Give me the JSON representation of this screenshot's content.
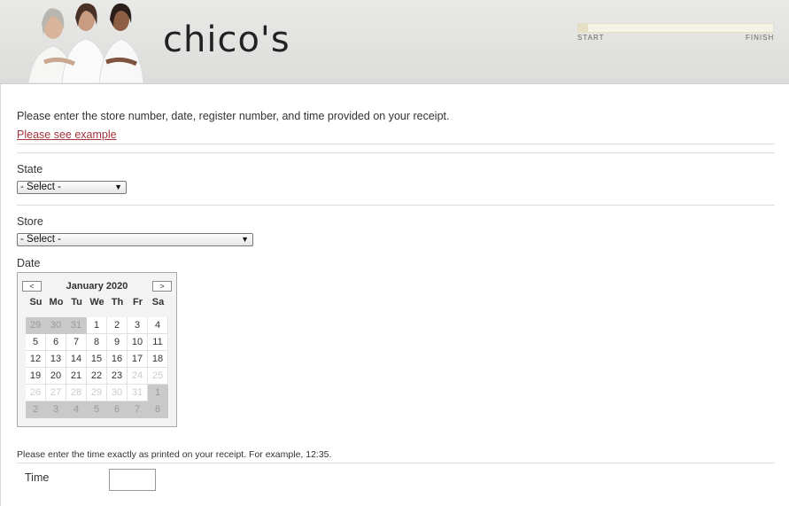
{
  "header": {
    "logo_text": "chico's",
    "progress": {
      "start_label": "START",
      "finish_label": "FINISH",
      "fraction": 0.05
    }
  },
  "intro": {
    "text": "Please enter the store number, date, register number, and time provided on your receipt.",
    "example_link": "Please see example"
  },
  "state": {
    "label": "State",
    "selected": "- Select -"
  },
  "store": {
    "label": "Store",
    "selected": "- Select -"
  },
  "date": {
    "label": "Date",
    "calendar": {
      "title": "January 2020",
      "prev_icon": "chevron-left-icon",
      "next_icon": "chevron-right-icon",
      "weekdays": [
        "Su",
        "Mo",
        "Tu",
        "We",
        "Th",
        "Fr",
        "Sa"
      ],
      "weeks": [
        [
          {
            "d": "29",
            "s": "other"
          },
          {
            "d": "30",
            "s": "other"
          },
          {
            "d": "31",
            "s": "other"
          },
          {
            "d": "1",
            "s": "active"
          },
          {
            "d": "2",
            "s": "active"
          },
          {
            "d": "3",
            "s": "active"
          },
          {
            "d": "4",
            "s": "active"
          }
        ],
        [
          {
            "d": "5",
            "s": "active"
          },
          {
            "d": "6",
            "s": "active"
          },
          {
            "d": "7",
            "s": "active"
          },
          {
            "d": "8",
            "s": "active"
          },
          {
            "d": "9",
            "s": "active"
          },
          {
            "d": "10",
            "s": "active"
          },
          {
            "d": "11",
            "s": "active"
          }
        ],
        [
          {
            "d": "12",
            "s": "active"
          },
          {
            "d": "13",
            "s": "active"
          },
          {
            "d": "14",
            "s": "active"
          },
          {
            "d": "15",
            "s": "active"
          },
          {
            "d": "16",
            "s": "active"
          },
          {
            "d": "17",
            "s": "active"
          },
          {
            "d": "18",
            "s": "active"
          }
        ],
        [
          {
            "d": "19",
            "s": "active"
          },
          {
            "d": "20",
            "s": "active"
          },
          {
            "d": "21",
            "s": "active"
          },
          {
            "d": "22",
            "s": "active"
          },
          {
            "d": "23",
            "s": "active"
          },
          {
            "d": "24",
            "s": "inactive"
          },
          {
            "d": "25",
            "s": "inactive"
          }
        ],
        [
          {
            "d": "26",
            "s": "inactive"
          },
          {
            "d": "27",
            "s": "inactive"
          },
          {
            "d": "28",
            "s": "inactive"
          },
          {
            "d": "29",
            "s": "inactive"
          },
          {
            "d": "30",
            "s": "inactive"
          },
          {
            "d": "31",
            "s": "inactive"
          },
          {
            "d": "1",
            "s": "other"
          }
        ],
        [
          {
            "d": "2",
            "s": "other"
          },
          {
            "d": "3",
            "s": "other"
          },
          {
            "d": "4",
            "s": "other"
          },
          {
            "d": "5",
            "s": "other"
          },
          {
            "d": "6",
            "s": "other"
          },
          {
            "d": "7",
            "s": "other"
          },
          {
            "d": "8",
            "s": "other"
          }
        ]
      ]
    }
  },
  "time": {
    "note": "Please enter the time exactly as printed on your receipt. For example, 12:35.",
    "label": "Time",
    "value": ""
  },
  "colors": {
    "link": "#a3343c",
    "progress_track": "#f5f3e6",
    "progress_fill": "#e6dfc4"
  }
}
